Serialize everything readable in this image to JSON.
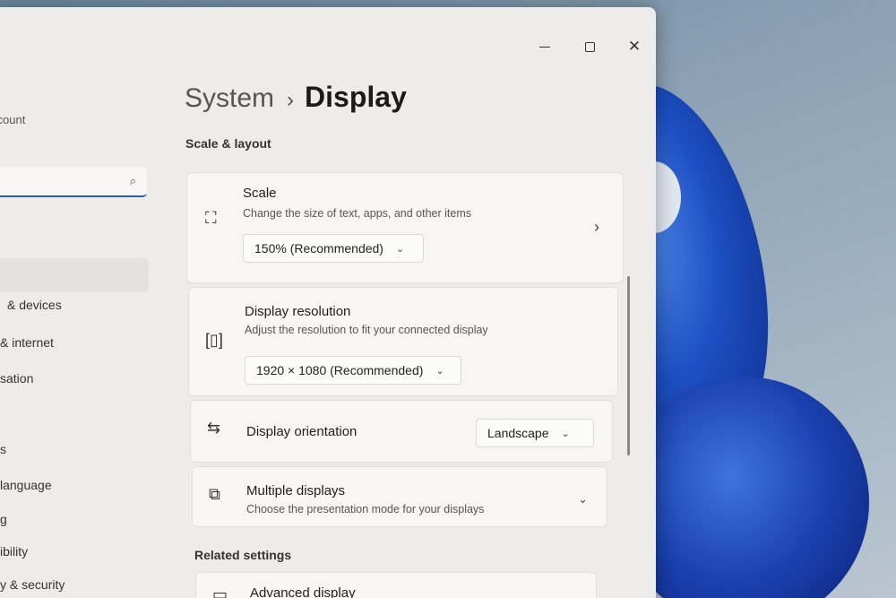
{
  "window": {
    "minimize_label": "minimize",
    "maximize_label": "maximize",
    "close_label": "✕"
  },
  "sidebar": {
    "account_text": "ccount",
    "search_placeholder": "",
    "items": [
      {
        "label": "& devices"
      },
      {
        "label": "& internet"
      },
      {
        "label": "sation"
      },
      {
        "label": "s"
      },
      {
        "label": "language"
      },
      {
        "label": "g"
      },
      {
        "label": "ibility"
      },
      {
        "label": "y & security"
      }
    ]
  },
  "breadcrumb": {
    "parent": "System",
    "separator": "›",
    "current": "Display"
  },
  "sections": {
    "scale_layout": "Scale & layout",
    "related_settings": "Related settings"
  },
  "cards": {
    "scale": {
      "icon": "resize-icon",
      "title": "Scale",
      "desc": "Change the size of text, apps, and other items",
      "value": "150% (Recommended)"
    },
    "resolution": {
      "icon": "resolution-icon",
      "title": "Display resolution",
      "desc": "Adjust the resolution to fit your connected display",
      "value": "1920 × 1080 (Recommended)"
    },
    "orientation": {
      "icon": "orientation-icon",
      "title": "Display orientation",
      "value": "Landscape"
    },
    "multiple": {
      "icon": "multiple-displays-icon",
      "title": "Multiple displays",
      "desc": "Choose the presentation mode for your displays"
    },
    "advanced": {
      "icon": "monitor-icon",
      "title": "Advanced display"
    }
  }
}
